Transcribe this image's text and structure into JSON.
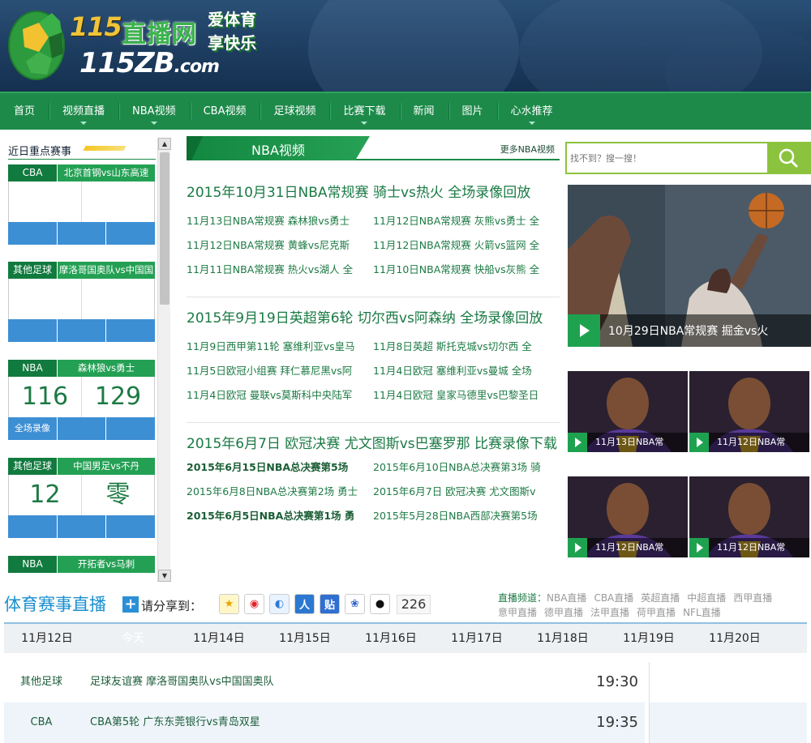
{
  "header": {
    "logo_num": "115",
    "logo_cn": "直播网",
    "logo_url_main": "115ZB",
    "logo_url_tld": ".com",
    "slogan_1": "爱体育",
    "slogan_2": "享快乐"
  },
  "nav": [
    "首页",
    "视频直播",
    "NBA视频",
    "CBA视频",
    "足球视频",
    "比赛下载",
    "新闻",
    "图片",
    "心水推荐"
  ],
  "left": {
    "title": "近日重点赛事",
    "matches": [
      {
        "cat": "CBA",
        "teams": "北京首钢vs山东高速",
        "home": "",
        "away": "",
        "foot": ""
      },
      {
        "cat": "其他足球",
        "teams": "摩洛哥国奥队vs中国国",
        "home": "",
        "away": "",
        "foot": ""
      },
      {
        "cat": "NBA",
        "teams": "森林狼vs勇士",
        "home": "116",
        "away": "129",
        "foot": "全场录像"
      },
      {
        "cat": "其他足球",
        "teams": "中国男足vs不丹",
        "home": "12",
        "away": "零",
        "foot": ""
      },
      {
        "cat": "NBA",
        "teams": "开拓者vs马刺",
        "home": "",
        "away": "",
        "foot": ""
      }
    ]
  },
  "mid": {
    "tab_label": "NBA视频",
    "more_link": "更多NBA视频",
    "sections": [
      {
        "head": "2015年10月31日NBA常规赛 骑士vs热火 全场录像回放",
        "rows": [
          [
            "11月13日NBA常规赛 森林狼vs勇士",
            "11月12日NBA常规赛 灰熊vs勇士 全"
          ],
          [
            "11月12日NBA常规赛 黄蜂vs尼克斯",
            "11月12日NBA常规赛 火箭vs篮网 全"
          ],
          [
            "11月11日NBA常规赛 热火vs湖人 全",
            "11月10日NBA常规赛 快船vs灰熊 全"
          ]
        ]
      },
      {
        "head": "2015年9月19日英超第6轮 切尔西vs阿森纳 全场录像回放",
        "rows": [
          [
            "11月9日西甲第11轮 塞维利亚vs皇马",
            "11月8日英超 斯托克城vs切尔西 全"
          ],
          [
            "11月5日欧冠小组赛 拜仁慕尼黑vs阿",
            "11月4日欧冠 塞维利亚vs曼城 全场"
          ],
          [
            "11月4日欧冠 曼联vs莫斯科中央陆军",
            "11月4日欧冠 皇家马德里vs巴黎圣日"
          ]
        ]
      },
      {
        "head": "2015年6月7日 欧冠决赛 尤文图斯vs巴塞罗那 比赛录像下载",
        "rows": [
          [
            "2015年6月15日NBA总决赛第5场",
            "2015年6月10日NBA总决赛第3场 骑"
          ],
          [
            "2015年6月8日NBA总决赛第2场 勇士",
            "2015年6月7日 欧冠决赛 尤文图斯v"
          ],
          [
            "2015年6月5日NBA总决赛第1场 勇",
            "2015年5月28日NBA西部决赛第5场"
          ]
        ]
      }
    ]
  },
  "right": {
    "search_placeholder": "找不到？搜一搜！",
    "big_caption": "10月29日NBA常规赛 掘金vs火",
    "small_captions": [
      "11月13日NBA常",
      "11月12日NBA常",
      "11月12日NBA常",
      "11月12日NBA常"
    ]
  },
  "bottom": {
    "live_title": "体育赛事直播",
    "plus": "+",
    "share_label": "请分享到：",
    "share_count": "226",
    "channels_label": "直播频道：",
    "channels": [
      "NBA直播",
      "CBA直播",
      "英超直播",
      "中超直播",
      "西甲直播",
      "意甲直播",
      "德甲直播",
      "法甲直播",
      "荷甲直播",
      "NFL直播"
    ],
    "dates": [
      "11月12日",
      "今天",
      "11月14日",
      "11月15日",
      "11月16日",
      "11月17日",
      "11月18日",
      "11月19日",
      "11月20日"
    ],
    "schedule": [
      {
        "cat": "其他足球",
        "desc": "足球友谊赛 摩洛哥国奥队vs中国国奥队",
        "time": "19:30"
      },
      {
        "cat": "CBA",
        "desc": "CBA第5轮 广东东莞银行vs青岛双星",
        "time": "19:35"
      }
    ]
  },
  "colors": {
    "brand_green": "#1d8a4a",
    "nav_bg": "#1d8a4a",
    "accent_blue": "#3d8fd4",
    "title_blue": "#1a8fd0",
    "search_green": "#8cc33e"
  }
}
